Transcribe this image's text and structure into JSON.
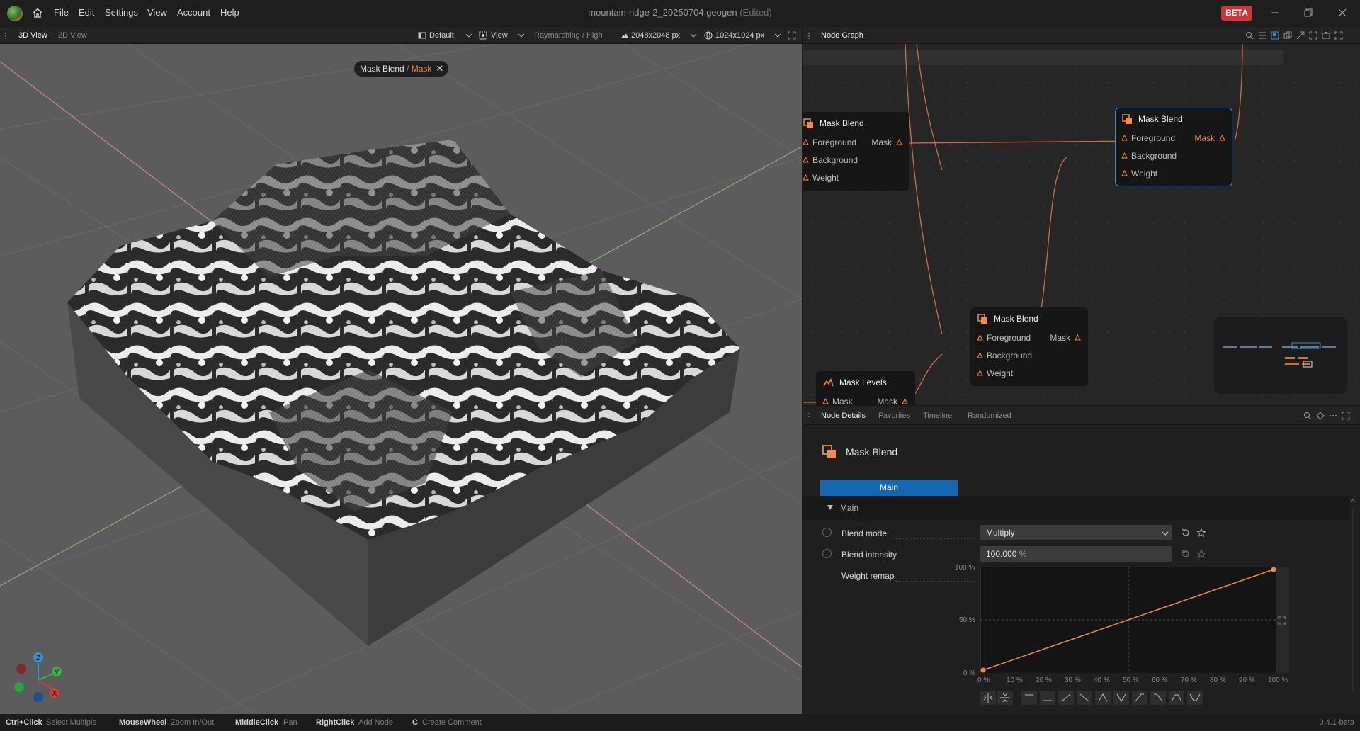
{
  "titlebar": {
    "menus": [
      "File",
      "Edit",
      "Settings",
      "View",
      "Account",
      "Help"
    ],
    "file_name": "mountain-ridge-2_20250704.geogen",
    "edited": "(Edited)",
    "badge": "BETA"
  },
  "view3d": {
    "tabs": [
      "3D View",
      "2D View"
    ],
    "preset": "Default",
    "view": "View",
    "render_mode": "Raymarching / High",
    "resolution": "2048x2048 px",
    "preview_resolution": "1024x1024 px",
    "chip": {
      "node": "Mask Blend",
      "sep": "/",
      "output": "Mask",
      "close": "✕"
    },
    "gizmo": {
      "z": "Z",
      "y": "Y",
      "x": "X"
    }
  },
  "graph": {
    "title": "Node Graph",
    "nodes": [
      {
        "title": "Mask Blend",
        "ports": [
          "Foreground",
          "Background",
          "Weight"
        ],
        "output": "Mask"
      },
      {
        "title": "Mask Blend",
        "ports": [
          "Foreground",
          "Background",
          "Weight"
        ],
        "output": "Mask"
      },
      {
        "title": "Mask Blend",
        "ports": [
          "Foreground",
          "Background",
          "Weight"
        ],
        "output": "Mask"
      },
      {
        "title": "Mask Levels",
        "ports": [
          "Mask"
        ],
        "output": "Mask"
      }
    ]
  },
  "details": {
    "tabs": [
      "Node Details",
      "Favorites",
      "Timeline",
      "Randomized"
    ],
    "node_title": "Mask Blend",
    "page_tab": "Main",
    "section": "Main",
    "blend_mode_label": "Blend mode",
    "blend_mode_value": "Multiply",
    "blend_intensity_label": "Blend intensity",
    "blend_intensity_value": "100.000",
    "blend_intensity_unit": "%",
    "weight_remap_label": "Weight remap",
    "y_ticks": [
      "100 %",
      "50 %",
      "0 %"
    ],
    "x_ticks": [
      "0 %",
      "10 %",
      "20 %",
      "30 %",
      "40 %",
      "50 %",
      "60 %",
      "70 %",
      "80 %",
      "90 %",
      "100 %"
    ]
  },
  "chart_data": {
    "type": "line",
    "x": [
      0,
      100
    ],
    "series": [
      {
        "values": [
          0,
          100
        ]
      }
    ],
    "xlim": [
      0,
      100
    ],
    "ylim": [
      0,
      100
    ],
    "grid": "dashed center lines"
  },
  "statusbar": {
    "hints": [
      {
        "key": "Ctrl+Click",
        "text": "Select Multiple"
      },
      {
        "key": "MouseWheel",
        "text": "Zoom In/Out"
      },
      {
        "key": "MiddleClick",
        "text": "Pan"
      },
      {
        "key": "RightClick",
        "text": "Add Node"
      },
      {
        "key": "C",
        "text": "Create Comment"
      }
    ],
    "version": "0.4.1-beta"
  },
  "colors": {
    "accent": "#f08a50",
    "selection": "#3b8fd6",
    "primary_tab": "#1467b0",
    "badge": "#d0343b"
  }
}
